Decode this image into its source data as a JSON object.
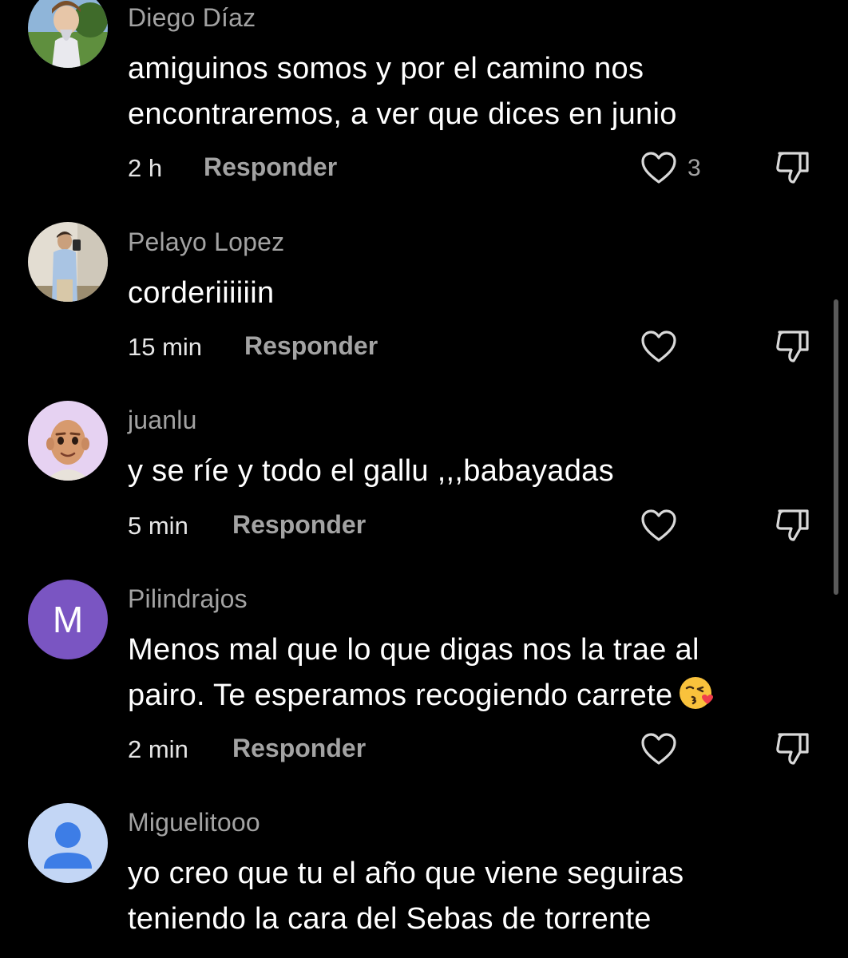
{
  "comments": [
    {
      "username": "Diego Díaz",
      "text": "amiguinos somos y por el camino nos\nencontraremos, a ver que dices en junio",
      "time": "2 h",
      "reply_label": "Responder",
      "likes": "3",
      "avatar": "photo-boy-outdoors"
    },
    {
      "username": "Pelayo Lopez",
      "text": "corderiiiiiin",
      "time": "15 min",
      "reply_label": "Responder",
      "likes": "",
      "avatar": "photo-mirror-selfie"
    },
    {
      "username": "juanlu",
      "text": "y se ríe y todo el gallu ,,,babayadas",
      "time": "5 min",
      "reply_label": "Responder",
      "likes": "",
      "avatar": "cartoon-face"
    },
    {
      "username": "Pilindrajos",
      "text": "Menos mal que lo que digas nos la trae al\npairo. Te esperamos recogiendo carrete",
      "time": "2 min",
      "reply_label": "Responder",
      "likes": "",
      "avatar_letter": "M",
      "avatar": "letter-avatar",
      "emoji": "kissing-face-with-heart"
    },
    {
      "username": "Miguelitooo",
      "text": "yo creo que tu el año que viene seguiras\nteniendo la cara del Sebas de torrente",
      "avatar": "default-person-avatar"
    }
  ],
  "colors": {
    "background": "#000000",
    "username": "#a3a3a3",
    "text": "#ffffff",
    "letter_avatar": "#7a55c2",
    "default_avatar": "#c3d6f5",
    "default_avatar_person": "#3d7de6"
  }
}
